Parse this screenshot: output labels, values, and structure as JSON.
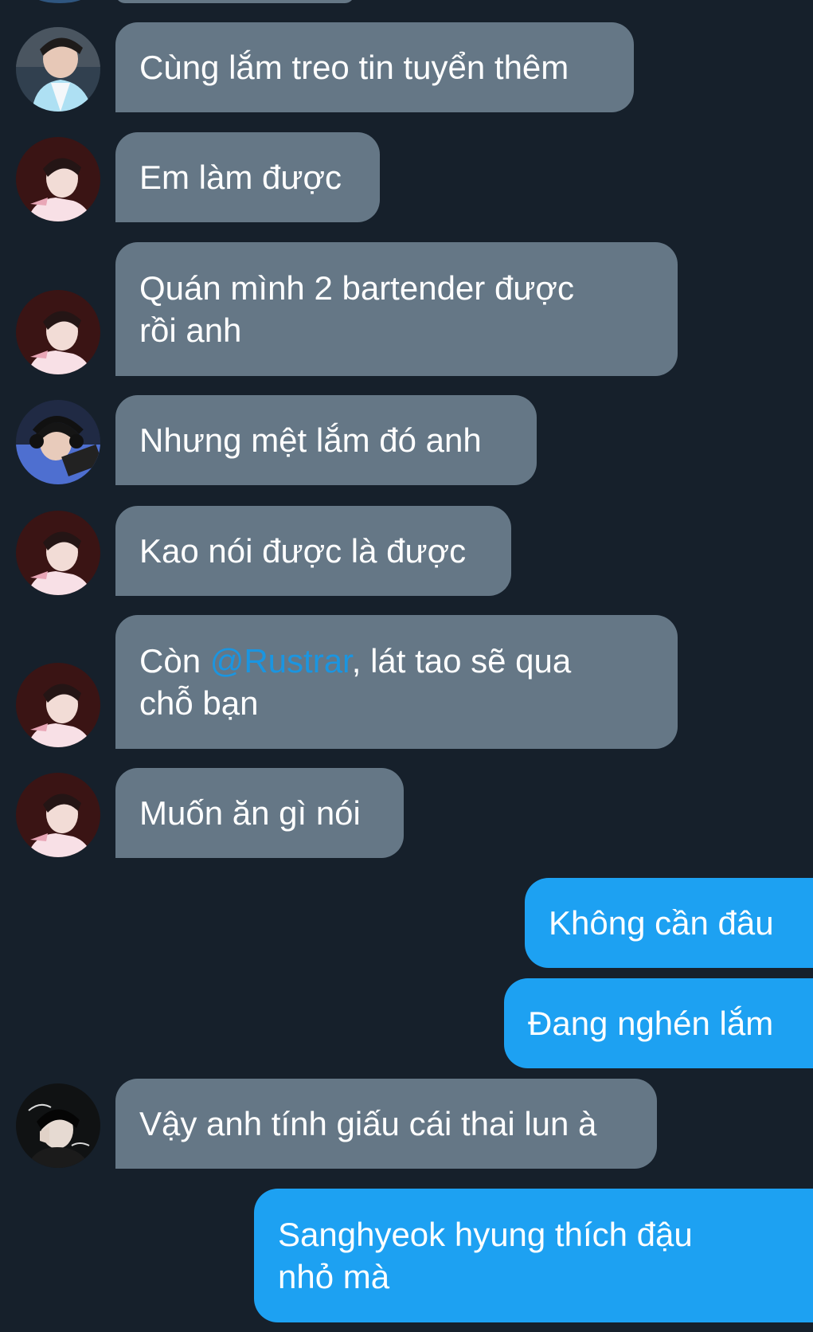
{
  "conversation": {
    "messages": [
      {
        "side": "incoming",
        "avatar": "avatar-user-blue-hanbok",
        "text": "Cùng lắm treo tin tuyển thêm"
      },
      {
        "side": "incoming",
        "avatar": "avatar-user-red-portrait",
        "text": "Em làm được"
      },
      {
        "side": "incoming",
        "avatar": "avatar-user-red-portrait",
        "text": "Quán mình 2 bartender được\nrồi anh"
      },
      {
        "side": "incoming",
        "avatar": "avatar-user-headset",
        "text": "Nhưng mệt lắm đó anh"
      },
      {
        "side": "incoming",
        "avatar": "avatar-user-red-portrait",
        "text": "Kao nói được là được"
      },
      {
        "side": "incoming",
        "avatar": "avatar-user-red-portrait",
        "prefix": "Còn ",
        "mention": "@Rustrar",
        "suffix": ", lát tao sẽ qua\nchỗ bạn"
      },
      {
        "side": "incoming",
        "avatar": "avatar-user-red-portrait",
        "text": "Muốn ăn gì nói"
      },
      {
        "side": "outgoing",
        "text": "Không cần đâu"
      },
      {
        "side": "outgoing",
        "text": "Đang nghén lắm"
      },
      {
        "side": "incoming",
        "avatar": "avatar-user-dark-portrait",
        "text": "Vậy anh tính giấu cái thai lun à"
      },
      {
        "side": "outgoing",
        "text": "Sanghyeok hyung thích đậu\nnhỏ mà"
      }
    ]
  },
  "colors": {
    "background": "#16202b",
    "incoming_bubble": "#657786",
    "outgoing_bubble": "#1da1f2",
    "mention": "#1b95e0",
    "text": "#ffffff"
  }
}
